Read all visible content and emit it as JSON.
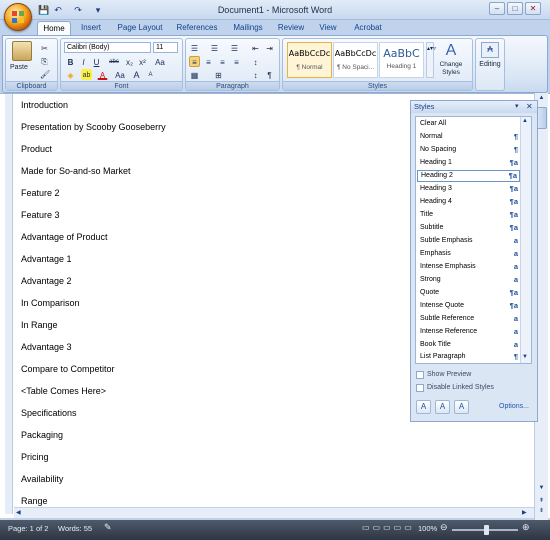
{
  "window": {
    "title": "Document1 - Microsoft Word",
    "buttons": [
      "–",
      "□",
      "✕"
    ]
  },
  "quick_access": {
    "icons": [
      "save-icon",
      "undo-icon",
      "redo-icon",
      "customize-icon"
    ],
    "glyphs": [
      "💾",
      "↶",
      "↷",
      "▾"
    ]
  },
  "tabs": [
    "Home",
    "Insert",
    "Page Layout",
    "References",
    "Mailings",
    "Review",
    "View",
    "Acrobat"
  ],
  "active_tab": "Home",
  "ribbon": {
    "clipboard": {
      "label": "Clipboard",
      "paste": "Paste"
    },
    "font": {
      "label": "Font",
      "name": "Calibri (Body)",
      "size": "11",
      "buttons_row1": [
        "A",
        "A",
        "🅰"
      ],
      "buttons_row2": [
        "B",
        "I",
        "U",
        "abc",
        "x₂",
        "x²",
        "Aa"
      ],
      "buttons_row3": [
        "A",
        "ab",
        "A",
        "Aa",
        "A",
        "A"
      ]
    },
    "paragraph": {
      "label": "Paragraph",
      "row1": [
        "☰",
        "☰",
        "☰",
        "⇤",
        "⇥",
        "↕",
        "¶"
      ],
      "row2": [
        "≡",
        "≡",
        "≡",
        "≡",
        "↕",
        "▦",
        "⊞"
      ]
    },
    "styles": {
      "label": "Styles",
      "gallery": [
        {
          "preview": "AaBbCcDc",
          "name": "¶ Normal"
        },
        {
          "preview": "AaBbCcDc",
          "name": "¶ No Spaci..."
        },
        {
          "preview": "AaBbC",
          "name": "Heading 1"
        }
      ],
      "change_styles": "Change Styles",
      "editing": "Editing"
    }
  },
  "document": {
    "lines": [
      "Introduction",
      "Presentation by Scooby Gooseberry",
      "Product",
      "Made for So-and-so Market",
      "Feature 2",
      "Feature 3",
      "Advantage of Product",
      "Advantage 1",
      "Advantage 2",
      "In Comparison",
      "In Range",
      "Advantage 3",
      "Compare to Competitor",
      "<Table Comes Here>",
      "Specifications",
      "Packaging",
      "Pricing",
      "Availability",
      "Range"
    ]
  },
  "styles_pane": {
    "title": "Styles",
    "items": [
      {
        "label": "Clear All",
        "marker": ""
      },
      {
        "label": "Normal",
        "marker": "¶"
      },
      {
        "label": "No Spacing",
        "marker": "¶"
      },
      {
        "label": "Heading 1",
        "marker": "¶a"
      },
      {
        "label": "Heading 2",
        "marker": "¶a"
      },
      {
        "label": "Heading 3",
        "marker": "¶a"
      },
      {
        "label": "Heading 4",
        "marker": "¶a"
      },
      {
        "label": "Title",
        "marker": "¶a"
      },
      {
        "label": "Subtitle",
        "marker": "¶a"
      },
      {
        "label": "Subtle Emphasis",
        "marker": "a"
      },
      {
        "label": "Emphasis",
        "marker": "a"
      },
      {
        "label": "Intense Emphasis",
        "marker": "a"
      },
      {
        "label": "Strong",
        "marker": "a"
      },
      {
        "label": "Quote",
        "marker": "¶a"
      },
      {
        "label": "Intense Quote",
        "marker": "¶a"
      },
      {
        "label": "Subtle Reference",
        "marker": "a"
      },
      {
        "label": "Intense Reference",
        "marker": "a"
      },
      {
        "label": "Book Title",
        "marker": "a"
      },
      {
        "label": "List Paragraph",
        "marker": "¶"
      }
    ],
    "selected": "Heading 2",
    "show_preview": "Show Preview",
    "disable_linked": "Disable Linked Styles",
    "options": "Options...",
    "bottom_buttons": [
      "A",
      "A",
      "A"
    ]
  },
  "status_bar": {
    "page": "Page: 1 of 2",
    "words": "Words: 55",
    "zoom": "100%"
  },
  "colors": {
    "accent": "#15428b",
    "ribbon_bg": "#dbe7f6",
    "status_bg": "#2d3642"
  }
}
